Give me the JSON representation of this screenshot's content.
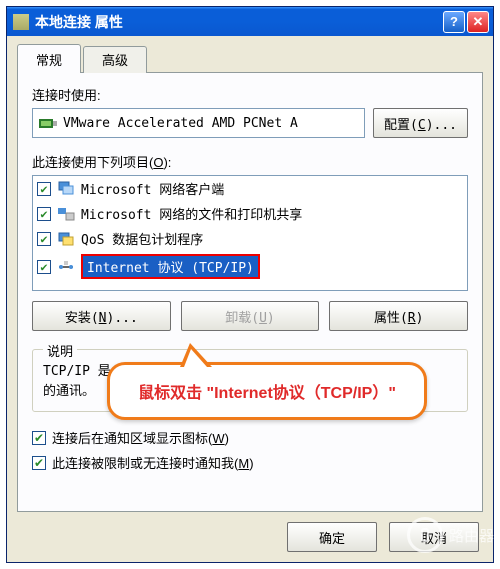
{
  "titlebar": {
    "title": "本地连接 属性",
    "help_label": "?",
    "close_label": "✕"
  },
  "tabs": {
    "general": "常规",
    "advanced": "高级"
  },
  "connect_using_label": "连接时使用:",
  "adapter_name": "VMware Accelerated AMD PCNet A",
  "configure_btn": "配置(C)...",
  "items_label": "此连接使用下列项目(O):",
  "items": [
    {
      "label": "Microsoft 网络客户端",
      "checked": true
    },
    {
      "label": "Microsoft 网络的文件和打印机共享",
      "checked": true
    },
    {
      "label": "QoS 数据包计划程序",
      "checked": true
    },
    {
      "label": "Internet 协议 (TCP/IP)",
      "checked": true,
      "selected": true
    }
  ],
  "buttons": {
    "install": "安装(N)...",
    "uninstall": "卸载(U)",
    "properties": "属性(R)"
  },
  "description": {
    "legend": "说明",
    "line1": "TCP/IP 是",
    "line2": "的通讯。"
  },
  "bottom_checks": [
    {
      "label": "连接后在通知区域显示图标(W)",
      "checked": true
    },
    {
      "label": "此连接被限制或无连接时通知我(M)",
      "checked": true
    }
  ],
  "dialog_buttons": {
    "ok": "确定",
    "cancel": "取消"
  },
  "callout": {
    "text": "鼠标双击 \"Internet协议（TCP/IP）\""
  },
  "watermark": {
    "text": "路由器"
  }
}
